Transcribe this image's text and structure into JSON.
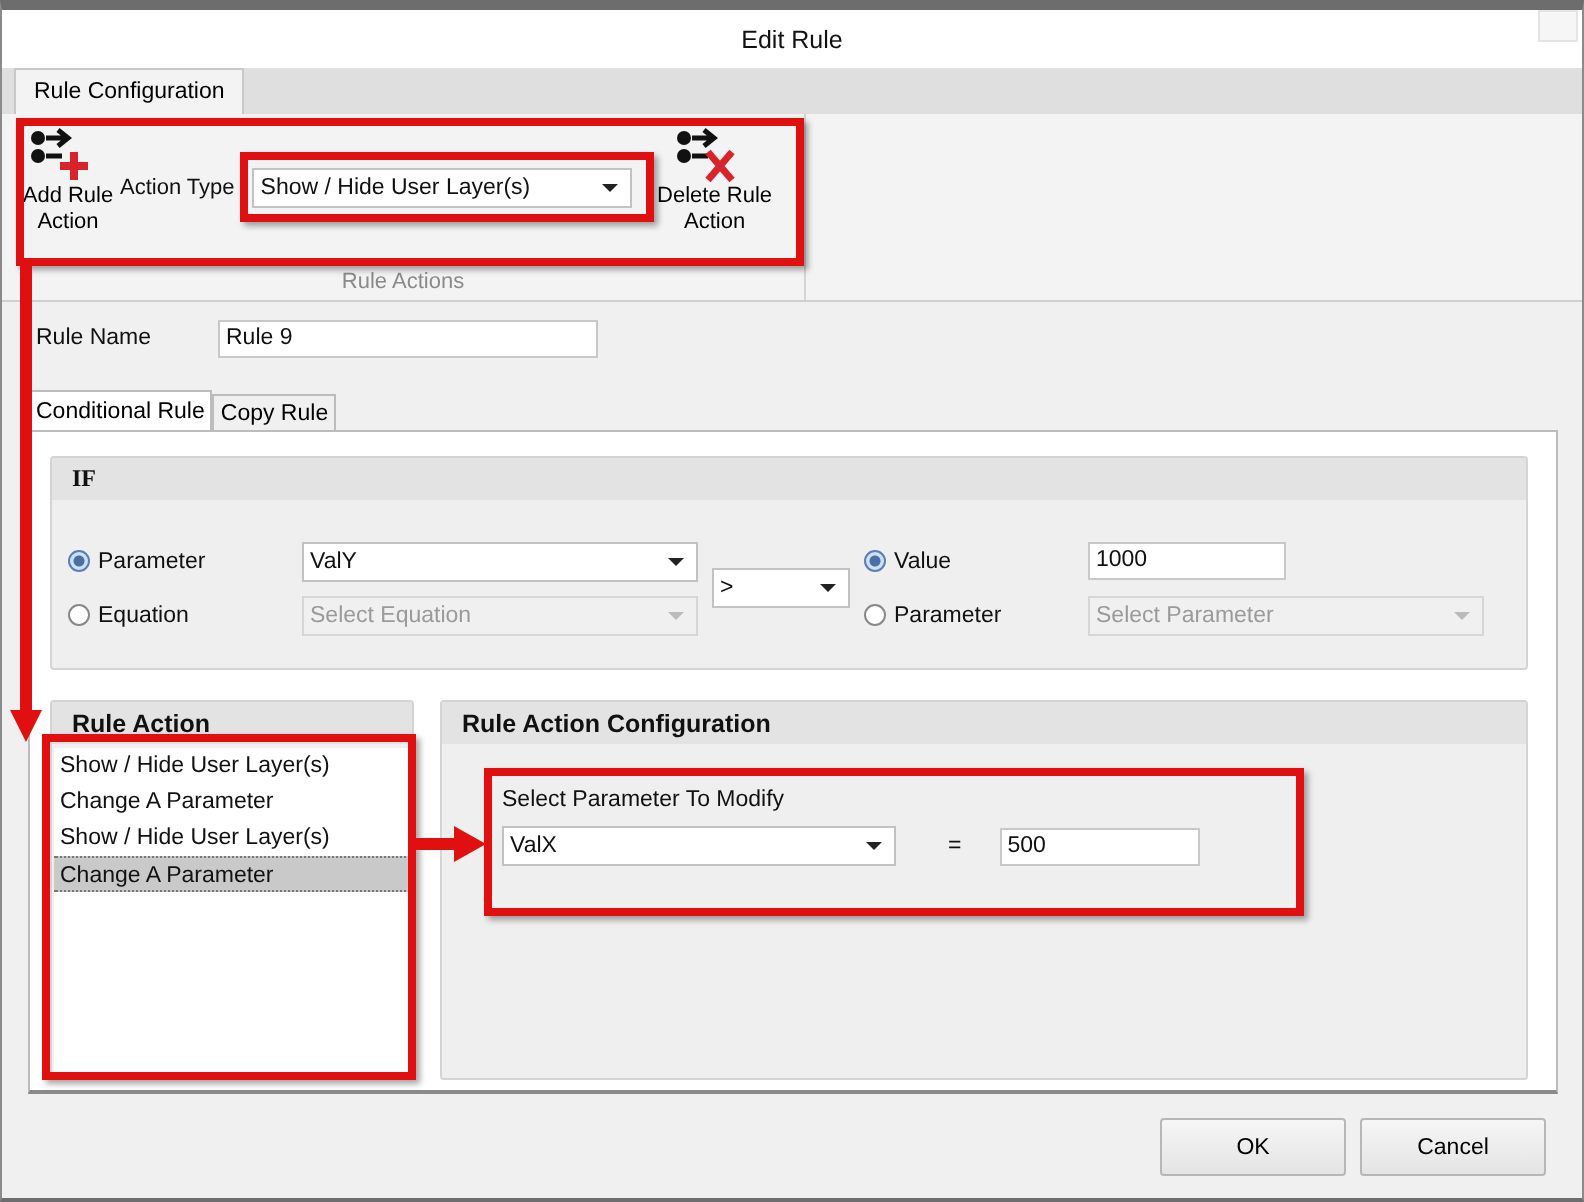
{
  "window": {
    "title": "Edit Rule"
  },
  "ribbon_tabs": [
    {
      "label": "Rule Configuration",
      "selected": true
    }
  ],
  "ribbon": {
    "add_button": "Add Rule Action",
    "action_type_label": "Action Type",
    "action_type_value": "Show / Hide User Layer(s)",
    "delete_button": "Delete Rule Action",
    "group_label": "Rule Actions"
  },
  "rule_name": {
    "label": "Rule Name",
    "value": "Rule 9"
  },
  "tabs": [
    {
      "label": "Conditional Rule",
      "selected": true
    },
    {
      "label": "Copy Rule",
      "selected": false
    }
  ],
  "if_group": {
    "title": "IF",
    "left_options": [
      {
        "label": "Parameter",
        "selected": true,
        "disabled": false,
        "value": "ValY"
      },
      {
        "label": "Equation",
        "selected": false,
        "disabled": true,
        "placeholder": "Select Equation"
      }
    ],
    "operator": ">",
    "right_options": [
      {
        "label": "Value",
        "selected": true,
        "kind": "text",
        "disabled": false,
        "value": "1000"
      },
      {
        "label": "Parameter",
        "selected": false,
        "kind": "dropdown",
        "disabled": true,
        "placeholder": "Select Parameter"
      }
    ]
  },
  "rule_action": {
    "title": "Rule Action",
    "items": [
      {
        "label": "Show / Hide User Layer(s)",
        "selected": false
      },
      {
        "label": "Change A Parameter",
        "selected": false
      },
      {
        "label": "Show / Hide User Layer(s)",
        "selected": false
      },
      {
        "label": "Change A Parameter",
        "selected": true
      }
    ]
  },
  "config": {
    "title": "Rule Action Configuration",
    "label": "Select Parameter To Modify",
    "parameter": "ValX",
    "equals": "=",
    "value": "500"
  },
  "buttons": [
    "OK",
    "Cancel"
  ]
}
